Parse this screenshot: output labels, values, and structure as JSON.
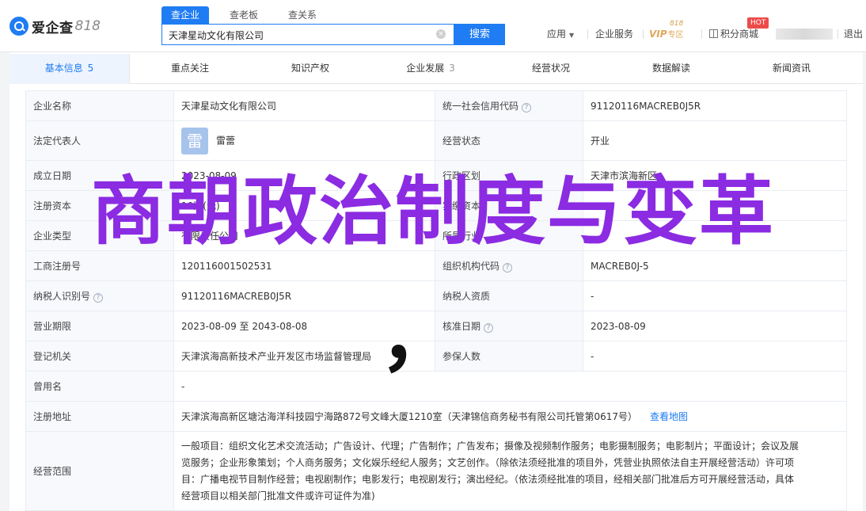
{
  "brand": {
    "name": "爱企查",
    "num": "818"
  },
  "search": {
    "tabs": [
      "查企业",
      "查老板",
      "查关系"
    ],
    "value": "天津星动文化有限公司",
    "clear_icon": "×",
    "button": "搜索"
  },
  "topnav": {
    "app": "应用",
    "service": "企业服务",
    "vip": "VIP",
    "vip_sub": "专区",
    "vip_badge": "818",
    "points": "积分商城",
    "hot": "HOT",
    "logout": "退出"
  },
  "sections": [
    {
      "label": "基本信息",
      "count": "5"
    },
    {
      "label": "重点关注",
      "count": ""
    },
    {
      "label": "知识产权",
      "count": ""
    },
    {
      "label": "企业发展",
      "count": "3"
    },
    {
      "label": "经营状况",
      "count": ""
    },
    {
      "label": "数据解读",
      "count": ""
    },
    {
      "label": "新闻资讯",
      "count": ""
    }
  ],
  "info": {
    "company_name_label": "企业名称",
    "company_name": "天津星动文化有限公司",
    "credit_code_label": "统一社会信用代码",
    "credit_code": "91120116MACREB0J5R",
    "legal_rep_label": "法定代表人",
    "legal_rep_avatar": "雷",
    "legal_rep": "雷蕾",
    "status_label": "经营状态",
    "status": "开业",
    "found_date_label": "成立日期",
    "found_date": "2023-08-09",
    "admin_region_label": "行政区划",
    "admin_region": "天津市滨海新区",
    "reg_capital_label": "注册资本",
    "reg_capital": "10万(元)",
    "paid_capital_label": "实缴资本",
    "paid_capital": "-",
    "company_type_label": "企业类型",
    "company_type": "有限责任公司",
    "industry_label": "所属行业",
    "industry": "",
    "biz_reg_no_label": "工商注册号",
    "biz_reg_no": "120116001502531",
    "org_code_label": "组织机构代码",
    "org_code": "MACREB0J-5",
    "taxpayer_id_label": "纳税人识别号",
    "taxpayer_id": "91120116MACREB0J5R",
    "taxpayer_qual_label": "纳税人资质",
    "taxpayer_qual": "-",
    "biz_term_label": "营业期限",
    "biz_term": "2023-08-09 至 2043-08-08",
    "approval_date_label": "核准日期",
    "approval_date": "2023-08-09",
    "reg_authority_label": "登记机关",
    "reg_authority": "天津滨海高新技术产业开发区市场监督管理局",
    "insured_label": "参保人数",
    "insured": "-",
    "former_name_label": "曾用名",
    "former_name": "-",
    "address_label": "注册地址",
    "address": "天津滨海高新区塘沽海洋科技园宁海路872号文峰大厦1210室（天津锦信商务秘书有限公司托管第0617号）",
    "map_link": "查看地图",
    "scope_label": "经营范围",
    "scope_lines": [
      "一般项目：组织文化艺术交流活动；广告设计、代理；广告制作；广告发布；摄像及视频制作服务；电影摄制服务；电影制片；平面设计；会议及展",
      "览服务；企业形象策划；个人商务服务；文化娱乐经纪人服务；文艺创作。（除依法须经批准的项目外，凭营业执照依法自主开展经营活动）许可项",
      "目：广播电视节目制作经营；电视剧制作；电影发行；电视剧发行；演出经纪。（依法须经批准的项目，经相关部门批准后方可开展经营活动，具体",
      "经营项目以相关部门批准文件或许可证件为准)"
    ],
    "help_icon": "?"
  },
  "overlay": {
    "title": "商朝政治制度与变革",
    "comma": "，"
  },
  "colors": {
    "accent": "#1f7cf3",
    "overlay_title": "#8b2be2",
    "hot": "#ee4a4a",
    "vip": "#e0a85a"
  }
}
